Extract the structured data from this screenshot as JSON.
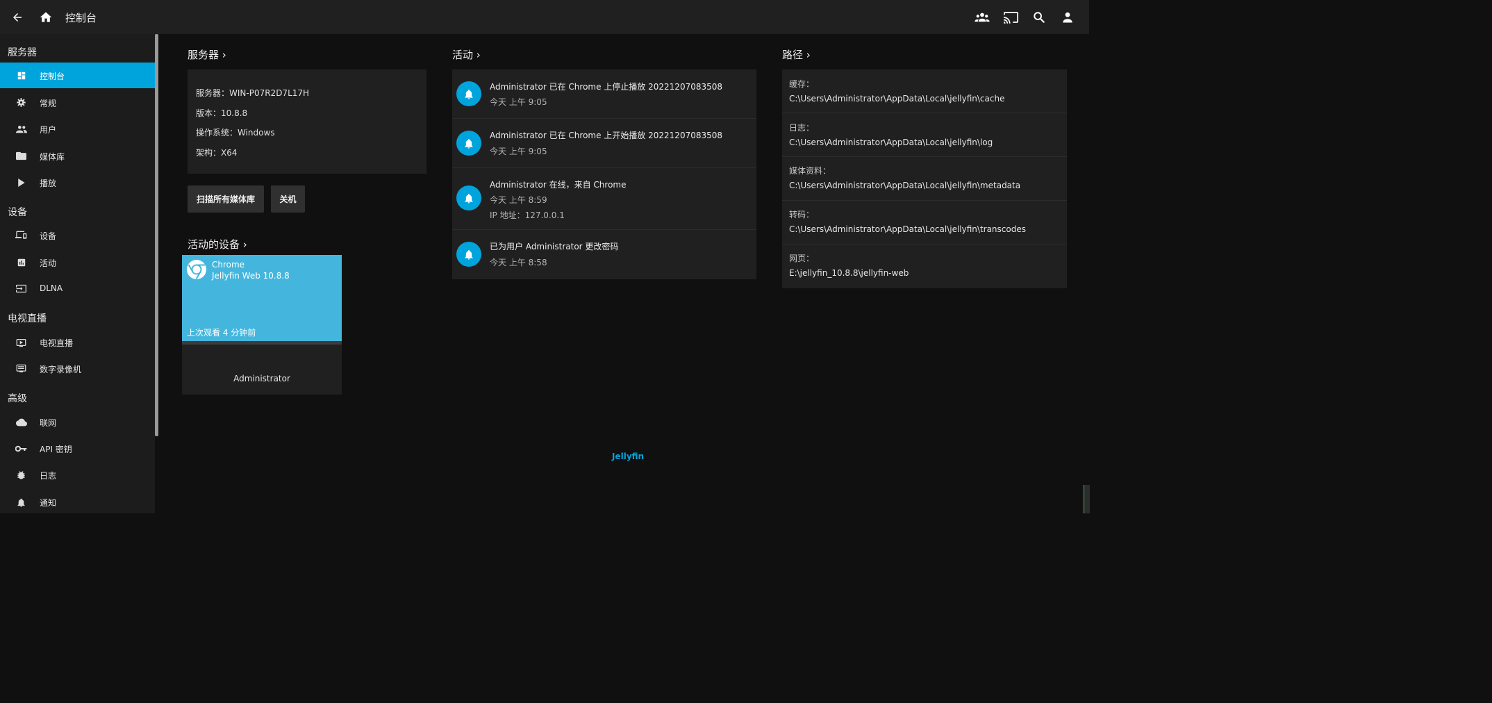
{
  "header": {
    "title": "控制台",
    "icons": [
      "back-arrow-icon",
      "home-icon",
      "users-icon",
      "cast-icon",
      "search-icon",
      "user-icon"
    ]
  },
  "sidebar": {
    "sections": [
      {
        "label": "服务器",
        "items": [
          {
            "label": "控制台",
            "icon": "dashboard-icon",
            "active": true
          },
          {
            "label": "常规",
            "icon": "gear-icon"
          },
          {
            "label": "用户",
            "icon": "users-icon"
          },
          {
            "label": "媒体库",
            "icon": "folder-icon"
          },
          {
            "label": "播放",
            "icon": "play-icon"
          }
        ]
      },
      {
        "label": "设备",
        "items": [
          {
            "label": "设备",
            "icon": "devices-icon"
          },
          {
            "label": "活动",
            "icon": "chart-icon"
          },
          {
            "label": "DLNA",
            "icon": "input-icon"
          }
        ]
      },
      {
        "label": "电视直播",
        "items": [
          {
            "label": "电视直播",
            "icon": "tv-play-icon"
          },
          {
            "label": "数字录像机",
            "icon": "dvr-icon"
          }
        ]
      },
      {
        "label": "高级",
        "items": [
          {
            "label": "联网",
            "icon": "cloud-icon"
          },
          {
            "label": "API 密钥",
            "icon": "key-icon"
          },
          {
            "label": "日志",
            "icon": "bug-icon"
          },
          {
            "label": "通知",
            "icon": "bell-icon"
          }
        ]
      }
    ]
  },
  "server": {
    "title": "服务器 ›",
    "lines": [
      "服务器：WIN-P07R2D7L17H",
      "版本：10.8.8",
      "操作系统：Windows",
      "架构：X64"
    ],
    "scan_button": "扫描所有媒体库",
    "shutdown_button": "关机"
  },
  "devices": {
    "title": "活动的设备 ›",
    "items": [
      {
        "app": "Chrome",
        "client": "Jellyfin Web 10.8.8",
        "last_seen": "上次观看 4 分钟前",
        "user": "Administrator",
        "icon": "chrome-icon"
      }
    ]
  },
  "activity": {
    "title": "活动 ›",
    "items": [
      {
        "text": "Administrator 已在 Chrome 上停止播放 20221207083508",
        "time": "今天 上午 9:05",
        "extra": ""
      },
      {
        "text": "Administrator 已在 Chrome 上开始播放 20221207083508",
        "time": "今天 上午 9:05",
        "extra": ""
      },
      {
        "text": "Administrator 在线，来自 Chrome",
        "time": "今天 上午 8:59",
        "extra": "IP 地址：127.0.0.1"
      },
      {
        "text": "已为用户 Administrator 更改密码",
        "time": "今天 上午 8:58",
        "extra": ""
      }
    ]
  },
  "paths": {
    "title": "路径 ›",
    "items": [
      {
        "label": "缓存：",
        "value": "C:\\Users\\Administrator\\AppData\\Local\\jellyfin\\cache"
      },
      {
        "label": "日志：",
        "value": "C:\\Users\\Administrator\\AppData\\Local\\jellyfin\\log"
      },
      {
        "label": "媒体资料：",
        "value": "C:\\Users\\Administrator\\AppData\\Local\\jellyfin\\metadata"
      },
      {
        "label": "转码：",
        "value": "C:\\Users\\Administrator\\AppData\\Local\\jellyfin\\transcodes"
      },
      {
        "label": "网页：",
        "value": "E:\\jellyfin_10.8.8\\jellyfin-web"
      }
    ]
  },
  "footer": {
    "link": "Jellyfin"
  },
  "colors": {
    "accent": "#00a4dc",
    "device_card": "#44b6dd",
    "background": "#101010",
    "panel": "#202020"
  }
}
